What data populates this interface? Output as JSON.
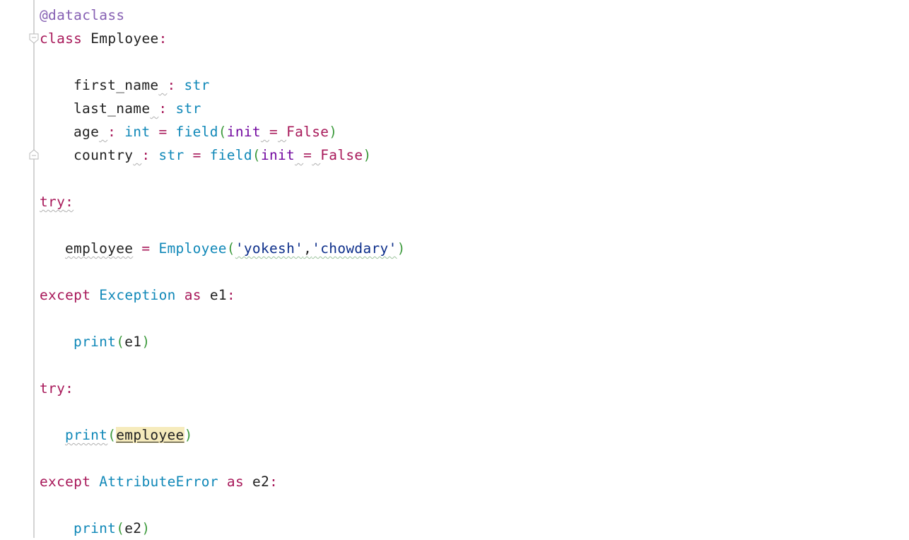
{
  "editor": {
    "lines": {
      "decorator": "@dataclass",
      "class_kw": "class",
      "class_name": "Employee",
      "colon": ":",
      "f1_name": "first_name",
      "f2_name": "last_name",
      "f3_name": "age",
      "f4_name": "country",
      "type_str": "str",
      "type_int": "int",
      "field_fn": "field",
      "init_kw": "init",
      "false_kw": "False",
      "try_kw": "try",
      "var_employee": "employee",
      "arg1": "'yokesh'",
      "arg2": "'chowdary'",
      "except_kw": "except",
      "exc1": "Exception",
      "as_kw": "as",
      "e1": "e1",
      "print_fn": "print",
      "exc2": "AttributeError",
      "e2": "e2"
    }
  }
}
